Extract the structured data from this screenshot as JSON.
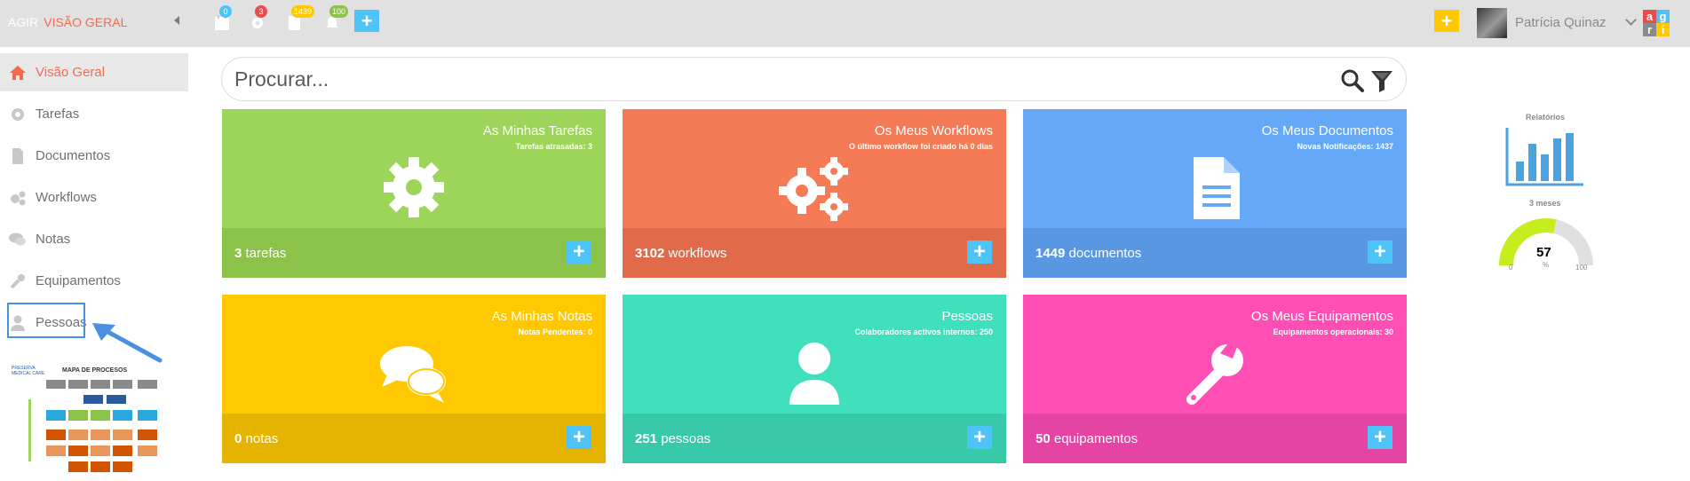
{
  "topbar": {
    "app_name": "AGIR",
    "section": "VISÃO GERAL",
    "badges": {
      "calendar": "0",
      "settings": "3",
      "documents": "1439",
      "notifications": "100"
    },
    "user_name": "Patrícia Quinaz",
    "logo_letters": [
      "a",
      "g",
      "r",
      "i"
    ]
  },
  "sidebar": {
    "items": [
      {
        "label": "Visão Geral",
        "icon": "home-icon"
      },
      {
        "label": "Tarefas",
        "icon": "gear-icon"
      },
      {
        "label": "Documentos",
        "icon": "document-icon"
      },
      {
        "label": "Workflows",
        "icon": "gears-icon"
      },
      {
        "label": "Notas",
        "icon": "chat-icon"
      },
      {
        "label": "Equipamentos",
        "icon": "wrench-icon"
      },
      {
        "label": "Pessoas",
        "icon": "user-icon"
      }
    ],
    "map_title": "MAPA DE PROCESOS",
    "map_org": "PRESERVA MEDICAL CARE"
  },
  "search": {
    "placeholder": "Procurar..."
  },
  "tiles": [
    {
      "title": "As Minhas Tarefas",
      "subtitle": "Tarefas atrasadas: 3",
      "count": "3",
      "unit": "tarefas",
      "color": "#9dd55b",
      "bottom": "#8bc34a",
      "icon": "gear-icon"
    },
    {
      "title": "Os Meus Workflows",
      "subtitle": "O último workflow foi criado há 0 dias",
      "count": "3102",
      "unit": "workflows",
      "color": "#f57b57",
      "bottom": "#e06a4a",
      "icon": "gears-icon"
    },
    {
      "title": "Os Meus Documentos",
      "subtitle": "Novas Notificações: 1437",
      "count": "1449",
      "unit": "documentos",
      "color": "#64a8f7",
      "bottom": "#5a97e3",
      "icon": "document-icon"
    },
    {
      "title": "As Minhas Notas",
      "subtitle": "Notas Pendentes: 0",
      "count": "0",
      "unit": "notas",
      "color": "#ffc800",
      "bottom": "#e5b400",
      "icon": "chat-icon"
    },
    {
      "title": "Pessoas",
      "subtitle": "Colaboradores activos internos: 250",
      "count": "251",
      "unit": "pessoas",
      "color": "#40e0bc",
      "bottom": "#38c9a8",
      "icon": "user-icon"
    },
    {
      "title": "Os Meus Equipamentos",
      "subtitle": "Equipamentos operacionais: 30",
      "count": "50",
      "unit": "equipamentos",
      "color": "#ff4fb5",
      "bottom": "#e544a2",
      "icon": "wrench-icon"
    }
  ],
  "widgets": {
    "reports_label": "Relatórios",
    "period_label": "3 meses",
    "gauge": {
      "value": "57",
      "unit": "%",
      "min": "0",
      "max": "100",
      "fraction": 0.57
    }
  }
}
